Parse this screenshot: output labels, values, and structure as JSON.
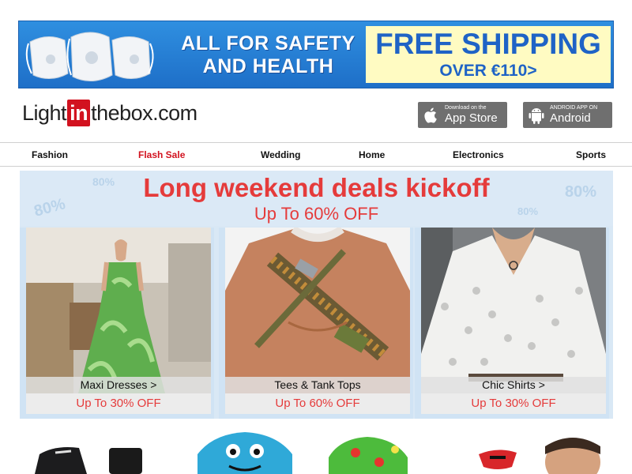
{
  "banner": {
    "line1": "ALL FOR SAFETY",
    "line2": "AND HEALTH",
    "ship_big": "FREE SHIPPING",
    "ship_small": "OVER €110>"
  },
  "header": {
    "logo_pre": "Light",
    "logo_in": "in",
    "logo_post": "thebox.com",
    "appstore_small": "Download on the",
    "appstore_big": "App Store",
    "android_small": "ANDROID APP ON",
    "android_big": "Android"
  },
  "nav": [
    "Fashion",
    "Flash Sale",
    "Wedding",
    "Home",
    "Electronics",
    "Sports"
  ],
  "deals": {
    "title": "Long weekend deals kickoff",
    "subtitle": "Up To 60% OFF",
    "splat_text": "80%",
    "cards": [
      {
        "caption": "Maxi Dresses >",
        "offer": "Up To 30% OFF"
      },
      {
        "caption": "Tees & Tank Tops",
        "offer": "Up To 60% OFF"
      },
      {
        "caption": "Chic Shirts >",
        "offer": "Up To 30% OFF"
      }
    ]
  },
  "colors": {
    "brand_red": "#d2121f",
    "accent_red": "#e53b3b",
    "banner_blue": "#1e6fc8",
    "ship_yellow": "#fffbc2"
  }
}
